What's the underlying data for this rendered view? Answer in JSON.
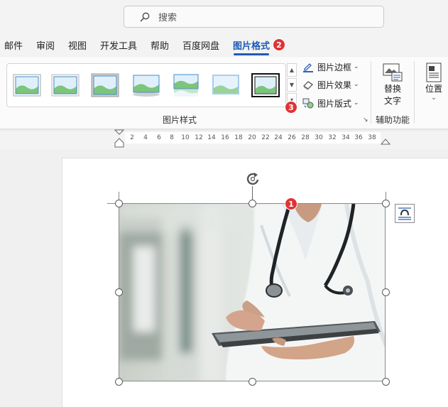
{
  "search": {
    "placeholder": "搜索"
  },
  "tabs": [
    {
      "label": "邮件"
    },
    {
      "label": "审阅"
    },
    {
      "label": "视图"
    },
    {
      "label": "开发工具"
    },
    {
      "label": "帮助"
    },
    {
      "label": "百度网盘"
    },
    {
      "label": "图片格式",
      "active": true
    }
  ],
  "badges": {
    "tab": "2",
    "picture": "1",
    "more": "3"
  },
  "ribbon": {
    "styles_group_label": "图片样式",
    "border_label": "图片边框",
    "effects_label": "图片效果",
    "layout_label": "图片版式",
    "alt_text_line1": "替换",
    "alt_text_line2": "文字",
    "accessibility_label": "辅助功能",
    "position_label": "位置"
  },
  "ruler": {
    "numbers": [
      "2",
      "4",
      "6",
      "8",
      "10",
      "12",
      "14",
      "16",
      "18",
      "20",
      "22",
      "24",
      "26",
      "28",
      "30",
      "32",
      "34",
      "36",
      "38"
    ]
  },
  "colors": {
    "accent": "#1e5bb7",
    "badge": "#e03333"
  }
}
